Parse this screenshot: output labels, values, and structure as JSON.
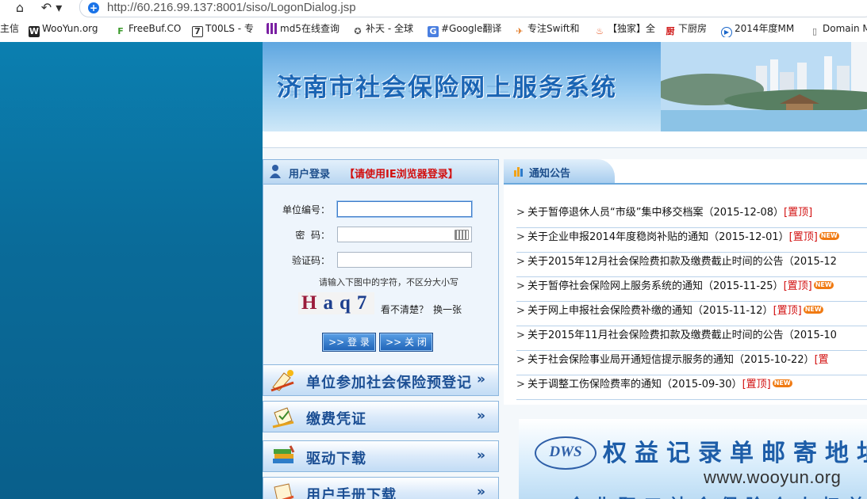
{
  "browser": {
    "url": "http://60.216.99.137:8001/siso/LogonDialog.jsp",
    "bookmarks": [
      {
        "label": "主信",
        "icon": "none"
      },
      {
        "label": "WooYun.org",
        "icon": "wooyun-icon"
      },
      {
        "label": "FreeBuf.CO",
        "icon": "freebuf-icon"
      },
      {
        "label": "T00LS - 专",
        "icon": "tools-icon"
      },
      {
        "label": "md5在线查询",
        "icon": "grid-icon"
      },
      {
        "label": "补天 - 全球",
        "icon": "star-icon"
      },
      {
        "label": "#Google翻译",
        "icon": "google-translate-icon"
      },
      {
        "label": "专注Swift和",
        "icon": "swift-icon"
      },
      {
        "label": "【独家】全",
        "icon": "flame-icon"
      },
      {
        "label": "下厨房",
        "icon": "kitchen-icon"
      },
      {
        "label": "2014年度MM",
        "icon": "play-icon"
      },
      {
        "label": "Domain M",
        "icon": "page-icon"
      }
    ]
  },
  "banner": {
    "title": "济南市社会保险网上服务系统"
  },
  "login": {
    "header": "用户登录",
    "warning": "【请使用IE浏览器登录】",
    "unit_label": "单位编号：",
    "password_label": "密  码：",
    "captcha_label": "验证码：",
    "hint": "请输入下图中的字符，不区分大小写",
    "captcha_text": "Haq7",
    "unclear": "看不清楚？",
    "refresh": "换一张",
    "login_button": ">> 登 录",
    "close_button": ">> 关 闭"
  },
  "menu": [
    {
      "label": "单位参加社会保险预登记",
      "arrow": "»"
    },
    {
      "label": "缴费凭证",
      "arrow": "»"
    },
    {
      "label": "驱动下载",
      "arrow": "»"
    },
    {
      "label": "用户手册下载",
      "arrow": "»"
    }
  ],
  "notices": {
    "header": "通知公告",
    "items": [
      {
        "text": "关于暂停退休人员“市级”集中移交档案（2015-12-08）",
        "tag": "[置顶]",
        "new": ""
      },
      {
        "text": "关于企业申报2014年度稳岗补贴的通知（2015-12-01）",
        "tag": "[置顶]",
        "new": "NEW"
      },
      {
        "text": "关于2015年12月社会保险费扣款及缴费截止时间的公告（2015-12",
        "tag": "",
        "new": ""
      },
      {
        "text": "关于暂停社会保险网上服务系统的通知（2015-11-25）",
        "tag": "[置顶]",
        "new": "NEW"
      },
      {
        "text": "关于网上申报社会保险费补缴的通知（2015-11-12）",
        "tag": "[置顶]",
        "new": "NEW"
      },
      {
        "text": "关于2015年11月社会保险费扣款及缴费截止时间的公告（2015-10",
        "tag": "",
        "new": ""
      },
      {
        "text": "关于社会保险事业局开通短信提示服务的通知（2015-10-22）",
        "tag": "[置",
        "new": ""
      },
      {
        "text": "关于调整工伤保险费率的通知（2015-09-30）",
        "tag": "[置顶]",
        "new": "NEW"
      }
    ]
  },
  "dws_banner": {
    "logo": "DWS",
    "title": "权益记录单邮寄地址",
    "subtitle": "企业职工社会保险个人权益记录"
  },
  "watermark": "www.wooyun.org"
}
